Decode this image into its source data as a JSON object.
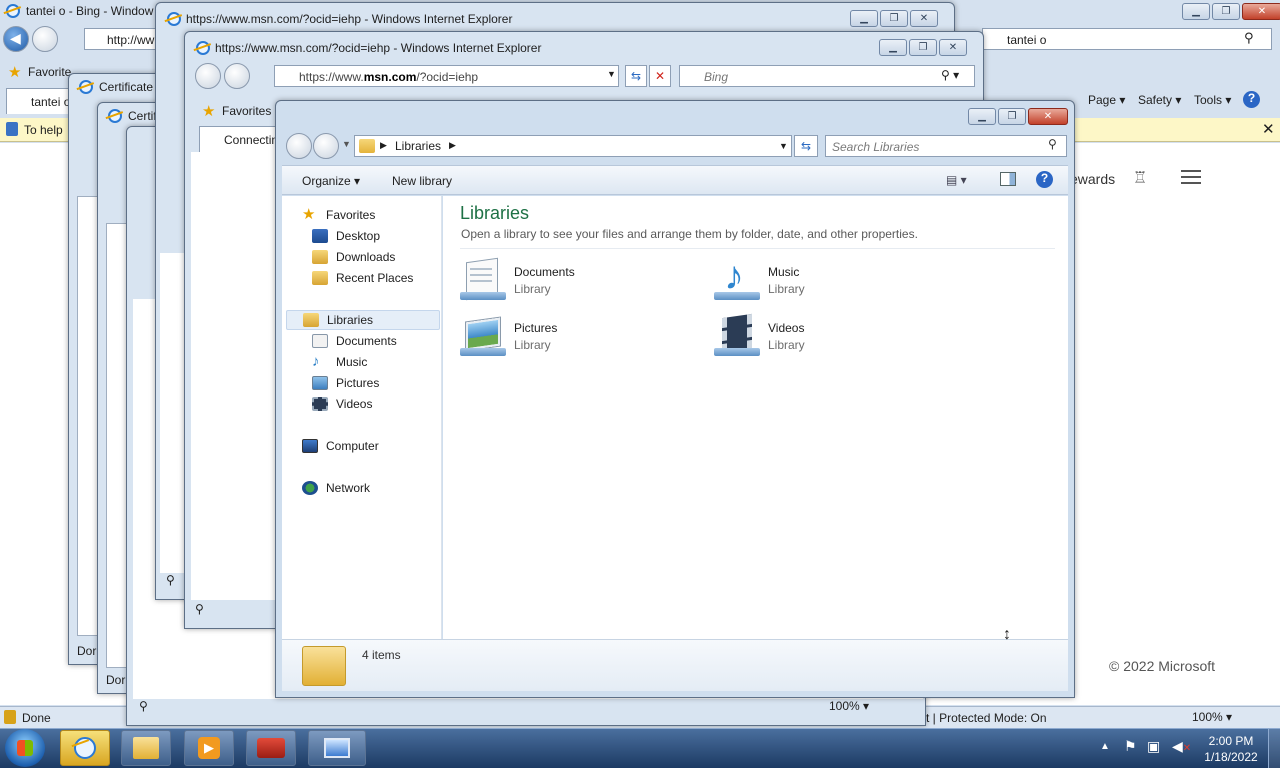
{
  "bg_window": {
    "title": "tantei o - Bing - Window",
    "address": "http://ww",
    "search": "tantei o",
    "favorites": "Favorite",
    "tab": "tantei o",
    "infobar": "To help",
    "menu": {
      "page": "Page",
      "safety": "Safety",
      "tools": "Tools"
    },
    "rewards": "ewards",
    "copyright": "© 2022 Microsoft",
    "status_done": "Done",
    "protected": "t | Protected Mode: On",
    "zoom": "100%"
  },
  "cert_windows": [
    {
      "title": "Certificate"
    },
    {
      "title": "Certif"
    }
  ],
  "ie_window_1": {
    "title": "https://www.msn.com/?ocid=iehp - Windows Internet Explorer"
  },
  "ie_window_2": {
    "title": "https://www.msn.com/?ocid=iehp - Windows Internet Explorer",
    "address": "https://www.msn.com/?ocid=iehp",
    "address_host": "msn.com",
    "search_placeholder": "Bing",
    "favorites": "Favorites",
    "tab": "Connectin",
    "zoom": "100%"
  },
  "small_status": {
    "done1": "Dor",
    "done2": "Dor"
  },
  "explorer": {
    "breadcrumb": "Libraries",
    "search_placeholder": "Search Libraries",
    "toolbar": {
      "organize": "Organize",
      "new_library": "New library"
    },
    "nav": {
      "favorites": "Favorites",
      "desktop": "Desktop",
      "downloads": "Downloads",
      "recent": "Recent Places",
      "libraries": "Libraries",
      "documents": "Documents",
      "music": "Music",
      "pictures": "Pictures",
      "videos": "Videos",
      "computer": "Computer",
      "network": "Network"
    },
    "heading": "Libraries",
    "subheading": "Open a library to see your files and arrange them by folder, date, and other properties.",
    "items": [
      {
        "name": "Documents",
        "type": "Library"
      },
      {
        "name": "Music",
        "type": "Library"
      },
      {
        "name": "Pictures",
        "type": "Library"
      },
      {
        "name": "Videos",
        "type": "Library"
      }
    ],
    "status": "4 items"
  },
  "taskbar": {
    "time": "2:00 PM",
    "date": "1/18/2022"
  },
  "colors": {
    "taskbar": "#1c3a63",
    "explorer_heading": "#1e7145",
    "link_blue": "#1a5aa8"
  }
}
